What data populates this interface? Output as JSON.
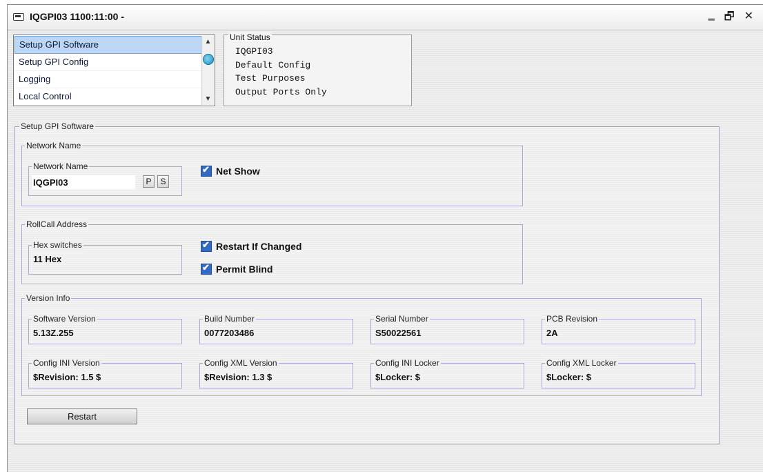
{
  "window": {
    "title": "IQGPI03  1100:11:00  -",
    "controls": [
      "‗",
      "🗗",
      "✕"
    ]
  },
  "nav": {
    "items": [
      "Setup GPI Software",
      "Setup GPI Config",
      "Logging",
      "Local Control"
    ],
    "selected_index": 0
  },
  "unit_status": {
    "label": "Unit Status",
    "lines": [
      "IQGPI03",
      "Default Config",
      "Test Purposes",
      "Output Ports Only"
    ]
  },
  "main": {
    "title": "Setup GPI Software",
    "network_name_group": {
      "title": "Network Name",
      "field_label": "Network Name",
      "value": "IQGPI03",
      "p_button": "P",
      "s_button": "S",
      "net_show": "Net Show"
    },
    "rollcall_group": {
      "title": "RollCall Address",
      "hex_label": "Hex switches",
      "hex_value": "11 Hex",
      "restart_if_changed": "Restart If Changed",
      "permit_blind": "Permit Blind"
    },
    "version_group": {
      "title": "Version Info",
      "software_version": {
        "label": "Software Version",
        "value": "5.13Z.255"
      },
      "build_number": {
        "label": "Build Number",
        "value": "0077203486"
      },
      "serial_number": {
        "label": "Serial Number",
        "value": "S50022561"
      },
      "pcb_revision": {
        "label": "PCB Revision",
        "value": "2A"
      },
      "config_ini_version": {
        "label": "Config INI Version",
        "value": "$Revision: 1.5 $"
      },
      "config_xml_version": {
        "label": "Config XML Version",
        "value": "$Revision: 1.3 $"
      },
      "config_ini_locker": {
        "label": "Config INI Locker",
        "value": "$Locker:  $"
      },
      "config_xml_locker": {
        "label": "Config XML Locker",
        "value": "$Locker:  $"
      }
    },
    "restart_button": "Restart"
  }
}
